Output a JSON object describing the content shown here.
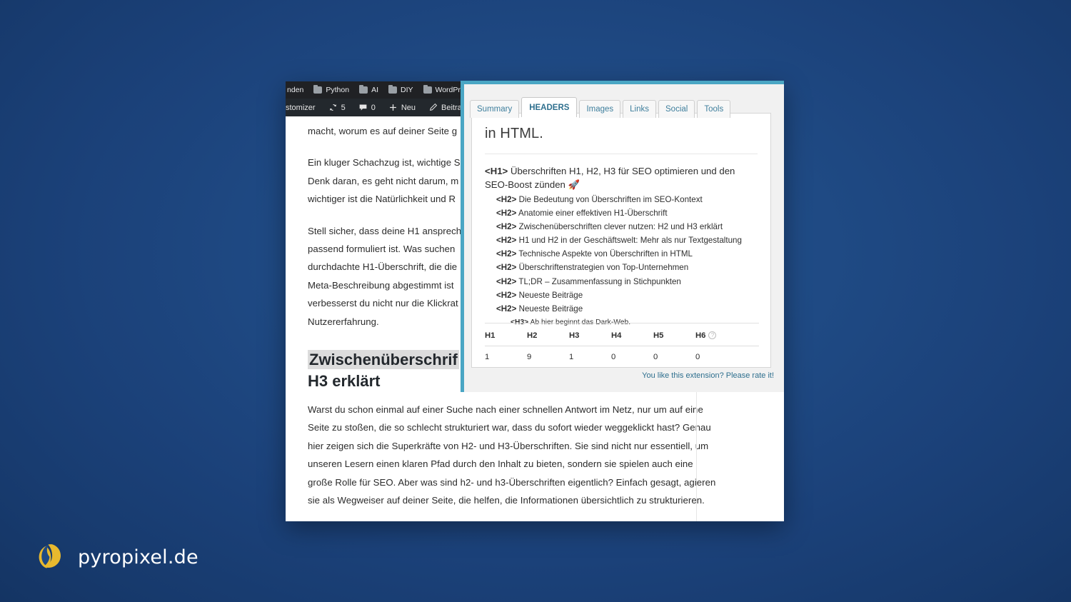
{
  "browser": {
    "bookmarks": [
      {
        "label": "nden",
        "icon": "folder-icon",
        "truncated_left": true
      },
      {
        "label": "Python",
        "icon": "folder-icon"
      },
      {
        "label": "AI",
        "icon": "folder-icon"
      },
      {
        "label": "DIY",
        "icon": "folder-icon"
      },
      {
        "label": "WordPress",
        "icon": "folder-icon"
      }
    ],
    "wp_adminbar": [
      {
        "label": "stomizer",
        "icon": "",
        "truncated_left": true
      },
      {
        "label": "5",
        "icon": "updates-icon"
      },
      {
        "label": "0",
        "icon": "comment-icon"
      },
      {
        "label": "Neu",
        "icon": "plus-icon"
      },
      {
        "label": "Beitrag bearb",
        "icon": "pencil-icon",
        "truncated_right": true
      }
    ]
  },
  "article": {
    "paragraphs": [
      "macht, worum es auf deiner Seite g",
      "Ein kluger Schachzug ist, wichtige S\nDenk daran, es geht nicht darum, m\nwichtiger ist die Natürlichkeit und R",
      "Stell sicher, dass deine H1 ansprech\npassend formuliert ist. Was suchen\ndurchdachte H1-Überschrift, die die\nMeta-Beschreibung abgestimmt ist\nverbesserst du nicht nur die Klickrat\nNutzererfahrung."
    ],
    "heading_line1": "Zwischenüberschrif",
    "heading_line2": "H3 erklärt",
    "last_paragraph": "Warst du schon einmal auf einer Suche nach einer schnellen Antwort im Netz, nur um auf eine Seite zu stoßen, die so schlecht strukturiert war, dass du sofort wieder weggeklickt hast? Genau hier zeigen sich die Superkräfte von H2- und H3-Überschriften. Sie sind nicht nur essentiell, um unseren Lesern einen klaren Pfad durch den Inhalt zu bieten, sondern sie spielen auch eine große Rolle für SEO. Aber was sind h2- und h3-Überschriften eigentlich? Einfach gesagt, agieren sie als Wegweiser auf deiner Seite, die helfen, die Informationen übersichtlich zu strukturieren."
  },
  "extension": {
    "tabs": [
      {
        "label": "Summary",
        "active": false
      },
      {
        "label": "HEADERS",
        "active": true
      },
      {
        "label": "Images",
        "active": false
      },
      {
        "label": "Links",
        "active": false
      },
      {
        "label": "Social",
        "active": false
      },
      {
        "label": "Tools",
        "active": false
      }
    ],
    "card_title": "in HTML.",
    "headings": [
      {
        "level": "<H1>",
        "lvl": 1,
        "text": "Überschriften H1, H2, H3 für SEO optimieren und den SEO-Boost zünden 🚀"
      },
      {
        "level": "<H2>",
        "lvl": 2,
        "text": "Die Bedeutung von Überschriften im SEO-Kontext"
      },
      {
        "level": "<H2>",
        "lvl": 2,
        "text": "Anatomie einer effektiven H1-Überschrift"
      },
      {
        "level": "<H2>",
        "lvl": 2,
        "text": "Zwischenüberschriften clever nutzen: H2 und H3 erklärt"
      },
      {
        "level": "<H2>",
        "lvl": 2,
        "text": "H1 und H2 in der Geschäftswelt: Mehr als nur Textgestaltung"
      },
      {
        "level": "<H2>",
        "lvl": 2,
        "text": "Technische Aspekte von Überschriften in HTML"
      },
      {
        "level": "<H2>",
        "lvl": 2,
        "text": "Überschriftenstrategien von Top-Unternehmen"
      },
      {
        "level": "<H2>",
        "lvl": 2,
        "text": "TL;DR – Zusammenfassung in Stichpunkten"
      },
      {
        "level": "<H2>",
        "lvl": 2,
        "text": "Neueste Beiträge"
      },
      {
        "level": "<H2>",
        "lvl": 2,
        "text": "Neueste Beiträge"
      },
      {
        "level": "<H3>",
        "lvl": 3,
        "text": "Ab hier beginnt das Dark-Web."
      }
    ],
    "counts": {
      "headers": [
        "H1",
        "H2",
        "H3",
        "H4",
        "H5",
        "H6"
      ],
      "values": [
        "1",
        "9",
        "1",
        "0",
        "0",
        "0"
      ],
      "help_badge": "?"
    },
    "rate_link": "You like this extension? Please rate it!"
  },
  "watermark": {
    "brand": "pyropixel.de",
    "logo_icon": "flame-logo-icon"
  },
  "colors": {
    "background_blue": "#1f4a84",
    "panel_accent": "#4aa6c4",
    "tab_text": "#3f7f9d",
    "logo_gold": "#e8b92e",
    "wp_bar": "#23282d",
    "chrome_bar": "#202124"
  }
}
